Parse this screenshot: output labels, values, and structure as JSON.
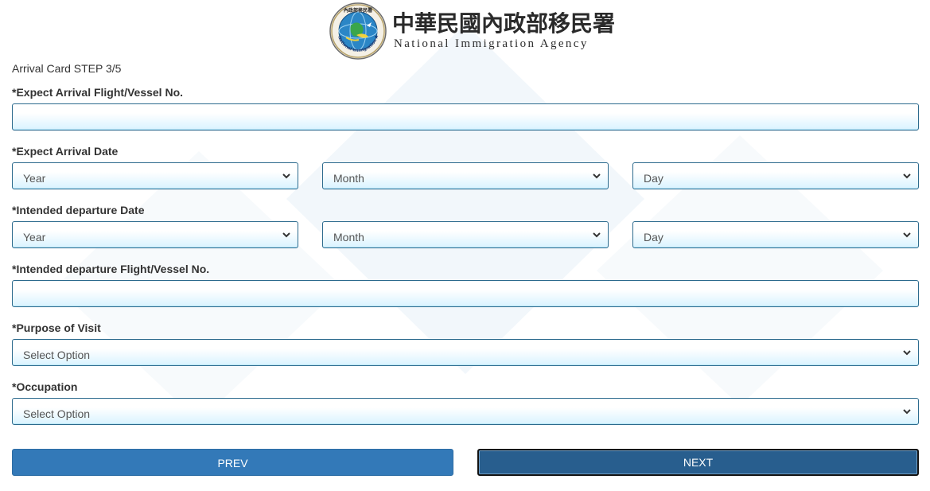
{
  "header": {
    "title_zh": "中華民國內政部移民署",
    "title_en": "National Immigration Agency",
    "logo_icon": "national-immigration-agency-seal",
    "logo_ring_text": "National Immigration Agency",
    "logo_top_text": "內政部移民署"
  },
  "form": {
    "step": "Arrival Card STEP 3/5",
    "arrival_flight": {
      "label": "*Expect Arrival Flight/Vessel No.",
      "value": ""
    },
    "arrival_date": {
      "label": "*Expect Arrival Date",
      "year": "Year",
      "month": "Month",
      "day": "Day"
    },
    "departure_date": {
      "label": "*Intended departure Date",
      "year": "Year",
      "month": "Month",
      "day": "Day"
    },
    "departure_flight": {
      "label": "*Intended departure Flight/Vessel No.",
      "value": ""
    },
    "purpose": {
      "label": "*Purpose of Visit",
      "selected": "Select Option"
    },
    "occupation": {
      "label": "*Occupation",
      "selected": "Select Option"
    }
  },
  "buttons": {
    "prev": "PREV",
    "next": "NEXT"
  },
  "colors": {
    "field_border": "#2c6a8d",
    "field_gradient_bottom": "#d9f3ff",
    "prev_button": "#3379b8",
    "next_button": "#285e8e",
    "background_shape": "#edf3f8"
  }
}
